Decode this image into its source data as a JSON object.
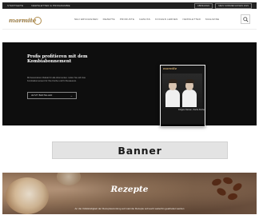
{
  "topbar": {
    "left_items": [
      "STARTSEITE",
      "NEWSLETTER & PROGRAMME"
    ],
    "right_buttons": [
      "ABMELDEN",
      "MEIN SOMMER-ESSEN 2023"
    ]
  },
  "header": {
    "logo_text": "marmite",
    "logo_sub": "DIE KOCHZEITSCHRIFT",
    "nav": [
      "NEU ERSCHIENEN",
      "REZEPTE",
      "PRODUKTE",
      "GENUSS",
      "KOCHEN LERNEN",
      "NEWSLETTER",
      "MAGAZINE"
    ]
  },
  "hero": {
    "title": "Profis profitieren mit dem Kombiabonnement",
    "text": "Mit besonderem Rabatt für alle Abonnenten. Holen Sie sich das Kombiabonnement für Ihre Küche und Ihr Restaurant.",
    "button_label": "JETZT BESTELLEN",
    "book": {
      "title": "marmite",
      "caption": "Jüngere Namen, frische Küche"
    }
  },
  "banner": {
    "label": "Banner"
  },
  "rezepte": {
    "title": "Rezepte",
    "subtitle": "An die Vollständigkeit der Rezeptsammlung auf marmite Rezepte soll auch weiterhin gearbeitet werden"
  },
  "colors": {
    "accent_gold": "#b08d4f",
    "hero_background": "#0e0e0e",
    "banner_background": "#e3e3e3"
  }
}
